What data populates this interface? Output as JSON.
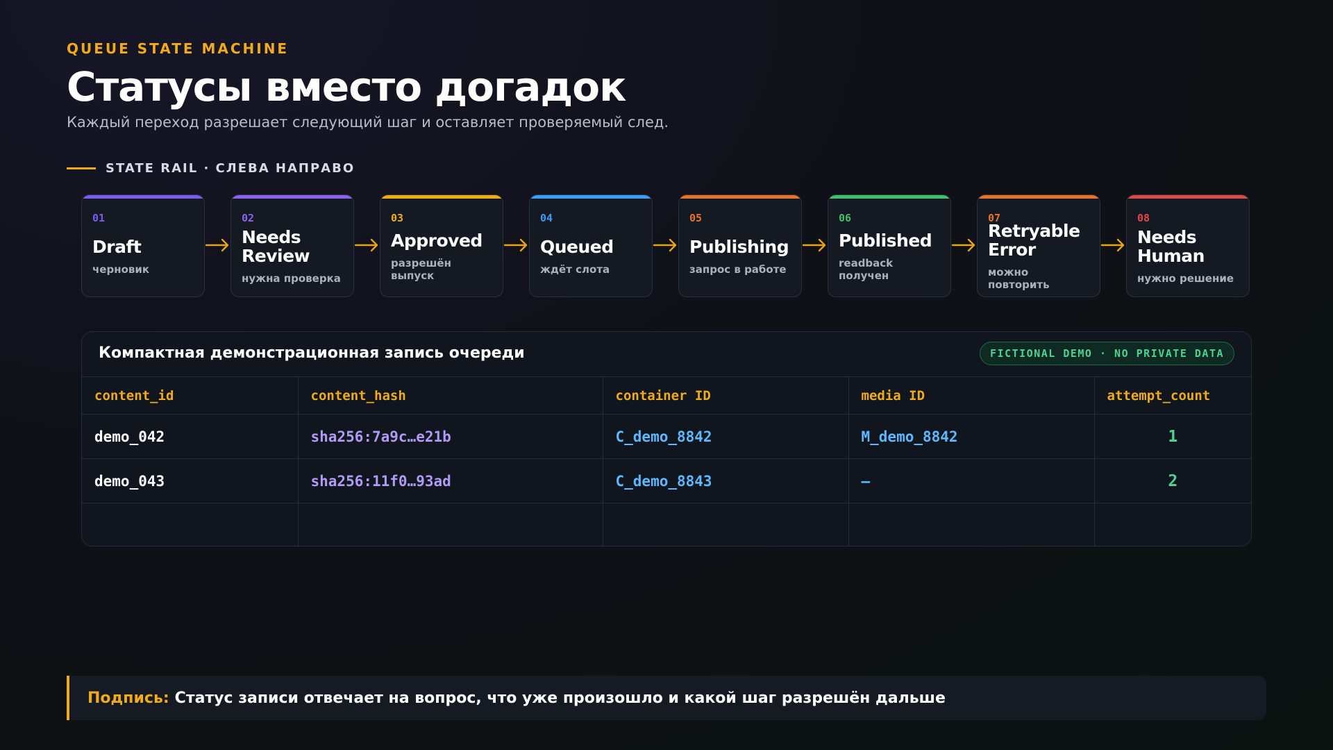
{
  "header": {
    "eyebrow": "QUEUE STATE MACHINE",
    "title": "Статусы вместо догадок",
    "subtitle": "Каждый переход разрешает следующий шаг и оставляет проверяемый след."
  },
  "rail": {
    "label": "STATE RAIL · СЛЕВА НАПРАВО",
    "arrow_color": "#e8a317",
    "states": [
      {
        "num": "01",
        "name": "Draft",
        "desc": "черновик",
        "color": "#7c5cf0"
      },
      {
        "num": "02",
        "name": "Needs Review",
        "desc": "нужна проверка",
        "color": "#8a62f2"
      },
      {
        "num": "03",
        "name": "Approved",
        "desc": "разрешён выпуск",
        "color": "#f0ab1b"
      },
      {
        "num": "04",
        "name": "Queued",
        "desc": "ждёт слота",
        "color": "#3b9cf5"
      },
      {
        "num": "05",
        "name": "Publishing",
        "desc": "запрос в работе",
        "color": "#e8722c"
      },
      {
        "num": "06",
        "name": "Published",
        "desc": "readback получен",
        "color": "#3fbf6e"
      },
      {
        "num": "07",
        "name": "Retryable Error",
        "desc": "можно повторить",
        "color": "#e8722c"
      },
      {
        "num": "08",
        "name": "Needs Human",
        "desc": "нужно решение",
        "color": "#e04848"
      }
    ]
  },
  "panel": {
    "title": "Компактная демонстрационная запись очереди",
    "badge": "FICTIONAL DEMO · NO PRIVATE DATA",
    "columns": [
      "content_id",
      "content_hash",
      "container ID",
      "media ID",
      "attempt_count"
    ],
    "rows": [
      {
        "content_id": "demo_042",
        "content_hash": "sha256:7a9c…e21b",
        "container_id": "C_demo_8842",
        "media_id": "M_demo_8842",
        "attempt_count": "1"
      },
      {
        "content_id": "demo_043",
        "content_hash": "sha256:11f0…93ad",
        "container_id": "C_demo_8843",
        "media_id": "—",
        "attempt_count": "2"
      }
    ]
  },
  "caption": {
    "label": "Подпись:",
    "text": "Статус записи отвечает на вопрос, что уже произошло и какой шаг разрешён дальше"
  }
}
